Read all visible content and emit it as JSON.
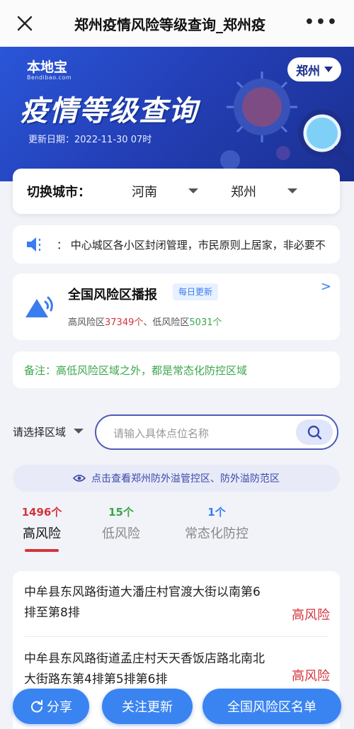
{
  "topbar": {
    "title": "郑州疫情风险等级查询_郑州疫"
  },
  "banner": {
    "logo": "本地宝",
    "logo_sub": "Bendibao.com",
    "title": "疫情等级查询",
    "update_label": "更新日期：",
    "update_date": "2022-11-30 07时",
    "city": "郑州"
  },
  "switch": {
    "label": "切换城市：",
    "province": "河南",
    "city": "郑州"
  },
  "notice": {
    "text": "：  中心城区各小区封闭管理，市民原则上居家，非必要不"
  },
  "broadcast": {
    "title": "全国风险区播报",
    "tag": "每日更新",
    "high_label": "高风险区",
    "high_count": "37349个",
    "sep": "、",
    "low_label": "低风险区",
    "low_count": "5031个"
  },
  "note": {
    "text": "备注：高低风险区域之外，都是常态化防控区域"
  },
  "filter": {
    "region": "请选择区域",
    "placeholder": "请输入具体点位名称"
  },
  "link": {
    "text": "点击查看郑州防外溢管控区、防外溢防范区"
  },
  "tabs": [
    {
      "count": "1496个",
      "label": "高风险",
      "color": "#d3343c",
      "active": true
    },
    {
      "count": "15个",
      "label": "低风险",
      "color": "#3aa64b",
      "active": false
    },
    {
      "count": "1个",
      "label": "常态化防控",
      "color": "#3b7cf0",
      "active": false
    }
  ],
  "list": [
    {
      "address": "中牟县东风路街道大潘庄村官渡大街以南第6排至第8排",
      "risk": "高风险"
    },
    {
      "address": "中牟县东风路街道孟庄村天天香饭店路北南北大街路东第4排第5排第6排",
      "risk": "高风险"
    }
  ],
  "bottom": {
    "share": "分享",
    "follow": "关注更新",
    "national": "全国风险区名单"
  }
}
